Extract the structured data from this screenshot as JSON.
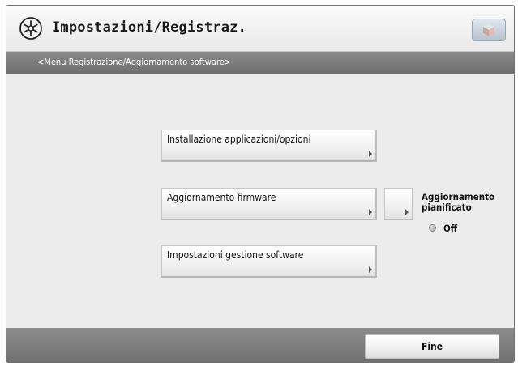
{
  "header": {
    "title": "Impostazioni/Registraz.",
    "title_icon": "settings-registration-icon",
    "corner_icon": "cube-icon"
  },
  "subheader": {
    "text": "<Menu Registrazione/Aggiornamento software>"
  },
  "menu": {
    "items": [
      {
        "label": "Installazione applicazioni/opzioni"
      },
      {
        "label": "Aggiornamento firmware"
      },
      {
        "label": "Impostazioni gestione software"
      }
    ]
  },
  "scheduled_update": {
    "label": "Aggiornamento\npianificato",
    "status": "Off"
  },
  "footer": {
    "done_label": "Fine"
  },
  "colors": {
    "titlebar": "#f2f2f2",
    "bars": "#7a7a7a",
    "background": "#ececec"
  }
}
